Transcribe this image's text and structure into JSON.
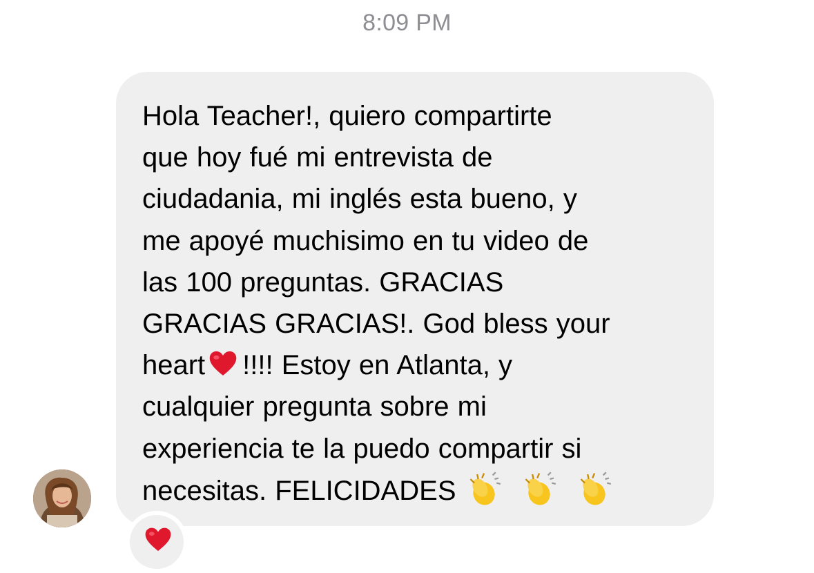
{
  "timestamp": "8:09 PM",
  "message": {
    "parts": {
      "p1": "Hola Teacher!, quiero compartirte\nque hoy fué mi entrevista de\nciudadania, mi inglés esta bueno, y\nme apoyé muchisimo en tu video de\nlas 100 preguntas. GRACIAS\nGRACIAS GRACIAS!. God bless your\nheart",
      "p2": "!!!!    Estoy en Atlanta,  y\ncualquier pregunta sobre mi\nexperiencia te la puedo compartir si\nnecesitas. FELICIDADES"
    },
    "emojis": {
      "inline_heart": "heart-emoji",
      "claps": [
        "clapping-hands-emoji",
        "clapping-hands-emoji",
        "clapping-hands-emoji"
      ]
    }
  },
  "reaction": {
    "emoji": "heart-emoji"
  },
  "colors": {
    "bubble_bg": "#efefef",
    "timestamp": "#8e8e93",
    "heart_red": "#e0182d",
    "clap_yellow": "#f7c51e"
  }
}
